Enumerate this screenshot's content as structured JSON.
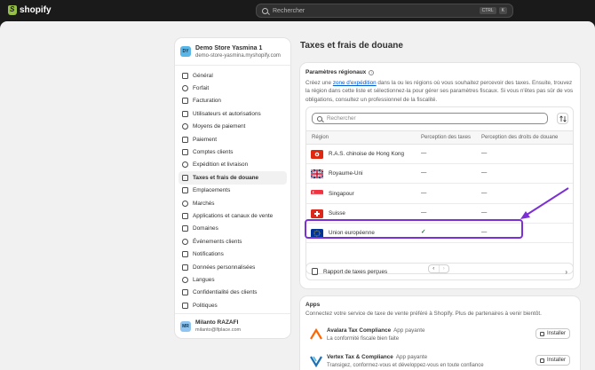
{
  "topbar": {
    "brand": "shopify",
    "search_placeholder": "Rechercher",
    "shortcut_keys": [
      "CTRL",
      "K"
    ]
  },
  "store": {
    "initials": "DY",
    "name": "Demo Store Yasmina 1",
    "url": "demo-store-yasmina.myshopify.com"
  },
  "nav": [
    {
      "label": "Général",
      "icon": "settings-icon"
    },
    {
      "label": "Forfait",
      "icon": "plan-icon"
    },
    {
      "label": "Facturation",
      "icon": "billing-icon"
    },
    {
      "label": "Utilisateurs et autorisations",
      "icon": "users-icon"
    },
    {
      "label": "Moyens de paiement",
      "icon": "payment-icon"
    },
    {
      "label": "Paiement",
      "icon": "checkout-icon"
    },
    {
      "label": "Comptes clients",
      "icon": "customer-accounts-icon"
    },
    {
      "label": "Expédition et livraison",
      "icon": "shipping-icon"
    },
    {
      "label": "Taxes et frais de douane",
      "icon": "taxes-icon",
      "active": true
    },
    {
      "label": "Emplacements",
      "icon": "location-icon"
    },
    {
      "label": "Marchés",
      "icon": "markets-icon"
    },
    {
      "label": "Applications et canaux de vente",
      "icon": "apps-icon"
    },
    {
      "label": "Domaines",
      "icon": "globe-icon"
    },
    {
      "label": "Événements clients",
      "icon": "events-icon"
    },
    {
      "label": "Notifications",
      "icon": "bell-icon"
    },
    {
      "label": "Données personnalisées",
      "icon": "data-icon"
    },
    {
      "label": "Langues",
      "icon": "language-icon"
    },
    {
      "label": "Confidentialité des clients",
      "icon": "lock-icon"
    },
    {
      "label": "Politiques",
      "icon": "policy-icon"
    }
  ],
  "user": {
    "initials": "MR",
    "name": "Milanto RAZAFI",
    "email": "milanto@lfplace.com"
  },
  "page": {
    "title": "Taxes et frais de douane"
  },
  "regional": {
    "title": "Paramètres régionaux",
    "desc_before": "Créez une ",
    "desc_link": "zone d'expédition",
    "desc_after": " dans la ou les régions où vous souhaitez percevoir des taxes. Ensuite, trouvez la région dans cette liste et sélectionnez-la pour gérer ses paramètres fiscaux. Si vous n'êtes pas sûr de vos obligations, consultez un professionnel de la fiscalité.",
    "search_placeholder": "Rechercher",
    "columns": [
      "Région",
      "Perception des taxes",
      "Perception des droits de douane"
    ],
    "rows": [
      {
        "region": "R.A.S. chinoise de Hong Kong",
        "flag": "hk",
        "taxes": "—",
        "duties": "—"
      },
      {
        "region": "Royaume-Uni",
        "flag": "gb",
        "taxes": "—",
        "duties": "—"
      },
      {
        "region": "Singapour",
        "flag": "sg",
        "taxes": "—",
        "duties": "—"
      },
      {
        "region": "Suisse",
        "flag": "ch",
        "taxes": "—",
        "duties": "—"
      },
      {
        "region": "Union européenne",
        "flag": "eu",
        "taxes": "✓",
        "duties": "—"
      }
    ],
    "pager_prev": "‹",
    "pager_next": "›",
    "report_label": "Rapport de taxes perçues"
  },
  "apps": {
    "title": "Apps",
    "desc": "Connectez votre service de taxe de vente préféré à Shopify. Plus de partenaires à venir bientôt.",
    "items": [
      {
        "name": "Avalara Tax Compliance",
        "badge": "App payante",
        "sub": "La conformité fiscale bien faite",
        "install": "Installer"
      },
      {
        "name": "Vertex Tax & Compliance",
        "badge": "App payante",
        "sub": "Transigez, conformez-vous et développez-vous en toute confiance",
        "install": "Installer"
      }
    ]
  },
  "colors": {
    "topbar": "#1a1a1a",
    "highlight": "#7b2fd4",
    "link": "#005bd3"
  }
}
